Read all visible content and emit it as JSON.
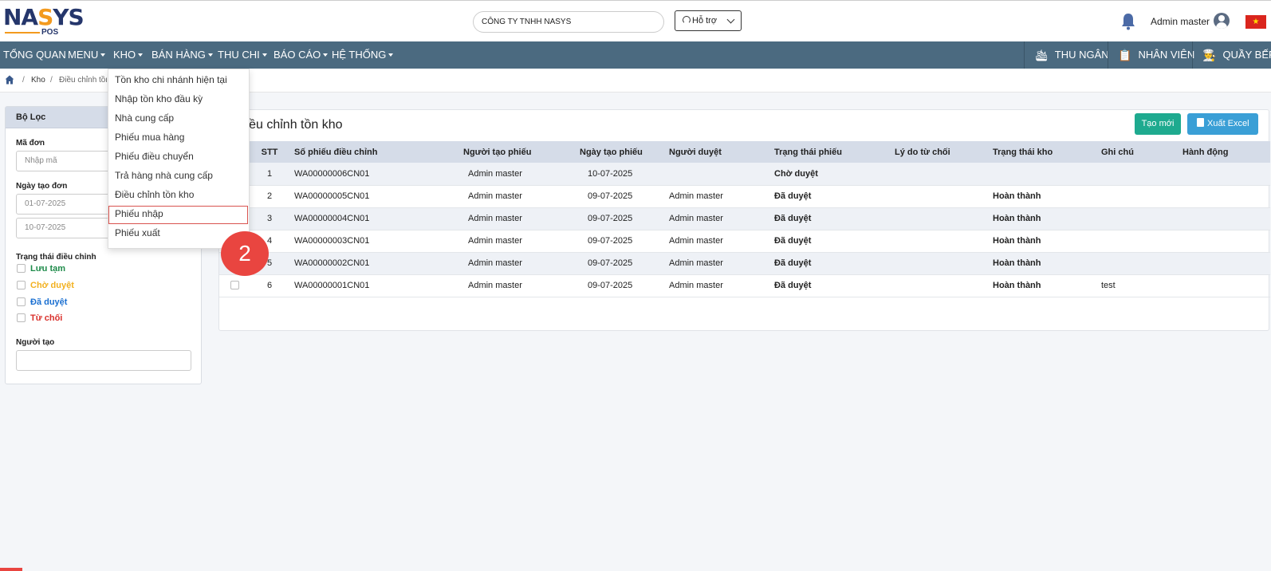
{
  "header": {
    "logo_brand": "NASYS",
    "logo_sub": "POS",
    "company": "CÔNG TY TNHH NASYS",
    "support_label": "Hỗ trợ",
    "user_name": "Admin master",
    "flag": "★"
  },
  "nav": {
    "items": [
      "TỔNG QUAN",
      "MENU",
      "KHO",
      "BÁN HÀNG",
      "THU CHI",
      "BÁO CÁO",
      "HỆ THỐNG"
    ],
    "right": [
      "THU NGÂN",
      "NHÂN VIÊN",
      "QUẦY BẾP"
    ]
  },
  "breadcrumb": {
    "sep": "/",
    "parent": "Kho",
    "current": "Điều chỉnh tồn kho"
  },
  "filter": {
    "title": "Bộ Lọc",
    "code_label": "Mã đơn",
    "code_placeholder": "Nhập mã",
    "date_label": "Ngày tạo đơn",
    "date_from": "01-07-2025",
    "date_to": "10-07-2025",
    "status_label": "Trạng thái điều chỉnh",
    "statuses": [
      "Lưu tạm",
      "Chờ duyệt",
      "Đã duyệt",
      "Từ chối"
    ],
    "creator_label": "Người tạo"
  },
  "main": {
    "title": "Điều chỉnh tồn kho",
    "btn_new": "Tạo mới",
    "btn_excel": "Xuất Excel",
    "columns": [
      "STT",
      "Số phiếu điều chỉnh",
      "Người tạo phiếu",
      "Ngày tạo phiếu",
      "Người duyệt",
      "Trạng thái phiếu",
      "Lý do từ chối",
      "Trạng thái kho",
      "Ghi chú",
      "Hành động"
    ],
    "rows": [
      {
        "stt": "1",
        "code": "WA00000006CN01",
        "creator": "Admin master",
        "date": "10-07-2025",
        "approver": "",
        "status": "Chờ duyệt",
        "reason": "",
        "stock": "",
        "note": ""
      },
      {
        "stt": "2",
        "code": "WA00000005CN01",
        "creator": "Admin master",
        "date": "09-07-2025",
        "approver": "Admin master",
        "status": "Đã duyệt",
        "reason": "",
        "stock": "Hoàn thành",
        "note": ""
      },
      {
        "stt": "3",
        "code": "WA00000004CN01",
        "creator": "Admin master",
        "date": "09-07-2025",
        "approver": "Admin master",
        "status": "Đã duyệt",
        "reason": "",
        "stock": "Hoàn thành",
        "note": ""
      },
      {
        "stt": "4",
        "code": "WA00000003CN01",
        "creator": "Admin master",
        "date": "09-07-2025",
        "approver": "Admin master",
        "status": "Đã duyệt",
        "reason": "",
        "stock": "Hoàn thành",
        "note": ""
      },
      {
        "stt": "5",
        "code": "WA00000002CN01",
        "creator": "Admin master",
        "date": "09-07-2025",
        "approver": "Admin master",
        "status": "Đã duyệt",
        "reason": "",
        "stock": "Hoàn thành",
        "note": ""
      },
      {
        "stt": "6",
        "code": "WA00000001CN01",
        "creator": "Admin master",
        "date": "09-07-2025",
        "approver": "Admin master",
        "status": "Đã duyệt",
        "reason": "",
        "stock": "Hoàn thành",
        "note": "test"
      }
    ]
  },
  "dropdown": {
    "items": [
      "Tồn kho chi nhánh hiện tại",
      "Nhập tồn kho đầu kỳ",
      "Nhà cung cấp",
      "Phiếu mua hàng",
      "Phiếu điều chuyển",
      "Trả hàng nhà cung cấp",
      "Điều chỉnh tồn kho",
      "Phiếu nhập",
      "Phiếu xuất"
    ]
  },
  "step_badge": "2",
  "colors": {
    "nav_bg": "#4b6a80",
    "accent_orange": "#f39a1e",
    "brand_navy": "#25366b",
    "link": "#1a6fd1",
    "pending": "#f2b01e",
    "badge": "#e94540"
  }
}
